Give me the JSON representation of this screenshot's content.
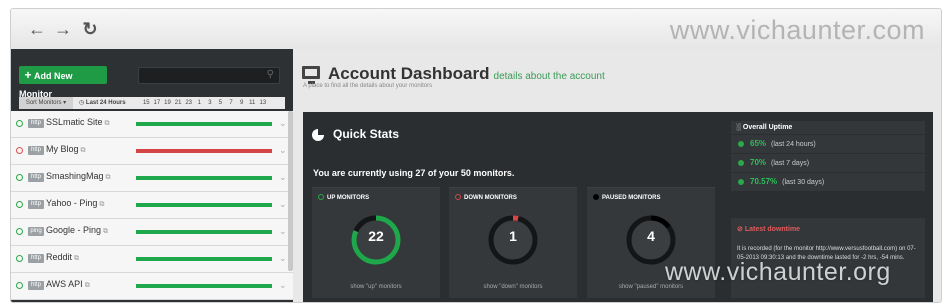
{
  "watermarks": {
    "top": "www.vichaunter.com",
    "bottom": "www.vichaunter.org"
  },
  "browser": {
    "icons": [
      "back-arrow-icon",
      "forward-arrow-icon",
      "reload-icon"
    ]
  },
  "sidebar": {
    "add_button": "Add New Monitor",
    "search_placeholder": "",
    "sort_label": "Sort Monitors",
    "hours_label": "Last 24 Hours",
    "hour_ticks": [
      "15",
      "17",
      "19",
      "21",
      "23",
      "1",
      "3",
      "5",
      "7",
      "9",
      "11",
      "13"
    ],
    "monitors": [
      {
        "type": "http",
        "name": "SSLmatic Site",
        "status": "up"
      },
      {
        "type": "http",
        "name": "My Blog",
        "status": "down"
      },
      {
        "type": "http",
        "name": "SmashingMag",
        "status": "up"
      },
      {
        "type": "http",
        "name": "Yahoo - Ping",
        "status": "up"
      },
      {
        "type": "ping",
        "name": "Google - Ping",
        "status": "up"
      },
      {
        "type": "http",
        "name": "Reddit",
        "status": "up"
      },
      {
        "type": "http",
        "name": "AWS API",
        "status": "up"
      }
    ]
  },
  "header": {
    "title": "Account Dashboard",
    "subtitle": "details about the account",
    "description": "A place to find all the details about your monitors"
  },
  "quick_stats": {
    "title": "Quick Stats",
    "usage_text": "You are currently using 27 of your 50 monitors.",
    "total_monitors": 27,
    "stats": [
      {
        "label": "UP MONITORS",
        "value": "22",
        "link": "show \"up\" monitors",
        "color": "#1fa84b"
      },
      {
        "label": "DOWN MONITORS",
        "value": "1",
        "link": "show \"down\" monitors",
        "color": "#d64545"
      },
      {
        "label": "PAUSED MONITORS",
        "value": "4",
        "link": "show \"paused\" monitors",
        "color": "#000000"
      }
    ]
  },
  "overall_uptime": {
    "title": "Overall Uptime",
    "rows": [
      {
        "pct": "65%",
        "period": "(last 24 hours)"
      },
      {
        "pct": "70%",
        "period": "(last 7 days)"
      },
      {
        "pct": "70.57%",
        "period": "(last 30 days)"
      }
    ]
  },
  "latest_downtime": {
    "title": "Latest downtime",
    "text": "It is recorded (for the monitor http://www.versusfootball.com) on 07-05-2013 09:30:13 and the downtime lasted for -2 hrs, -54 mins."
  },
  "colors": {
    "up": "#1fa84b",
    "down": "#d64545",
    "accent": "#3a9b57",
    "panel": "#2b2e31"
  }
}
